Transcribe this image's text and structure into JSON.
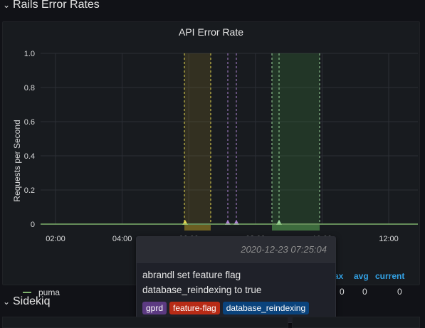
{
  "rows": {
    "rails": {
      "title": "Rails Error Rates"
    },
    "sidekiq": {
      "title": "Sidekiq"
    }
  },
  "panel": {
    "title": "API Error Rate",
    "ylabel": "Requests per Second"
  },
  "chart_data": {
    "type": "line",
    "title": "API Error Rate",
    "ylabel": "Requests per Second",
    "xlabel": "",
    "y_ticks": [
      "0",
      "0.2",
      "0.4",
      "0.6",
      "0.8",
      "1.0"
    ],
    "x_ticks": [
      "02:00",
      "04:00",
      "06:00",
      "08:00",
      "10:00",
      "12:00"
    ],
    "ylim": [
      0,
      1.0
    ],
    "series": [
      {
        "name": "puma",
        "color": "#7eb26d",
        "x": [
          "02:00",
          "04:00",
          "06:00",
          "08:00",
          "10:00",
          "12:00"
        ],
        "values": [
          0,
          0,
          0,
          0,
          0,
          0
        ]
      }
    ]
  },
  "legend": {
    "series_name": "puma",
    "headers": {
      "max": "ax",
      "avg": "avg",
      "current": "current"
    },
    "values": {
      "max": "0",
      "avg": "0",
      "current": "0"
    }
  },
  "tooltip": {
    "time": "2020-12-23 07:25:04",
    "text": "abrandl set feature flag database_reindexing to true",
    "tags": [
      {
        "label": "gprd",
        "color": "#5c3a82"
      },
      {
        "label": "feature-flag",
        "color": "#b82b16"
      },
      {
        "label": "database_reindexing",
        "color": "#0a437c"
      }
    ]
  }
}
